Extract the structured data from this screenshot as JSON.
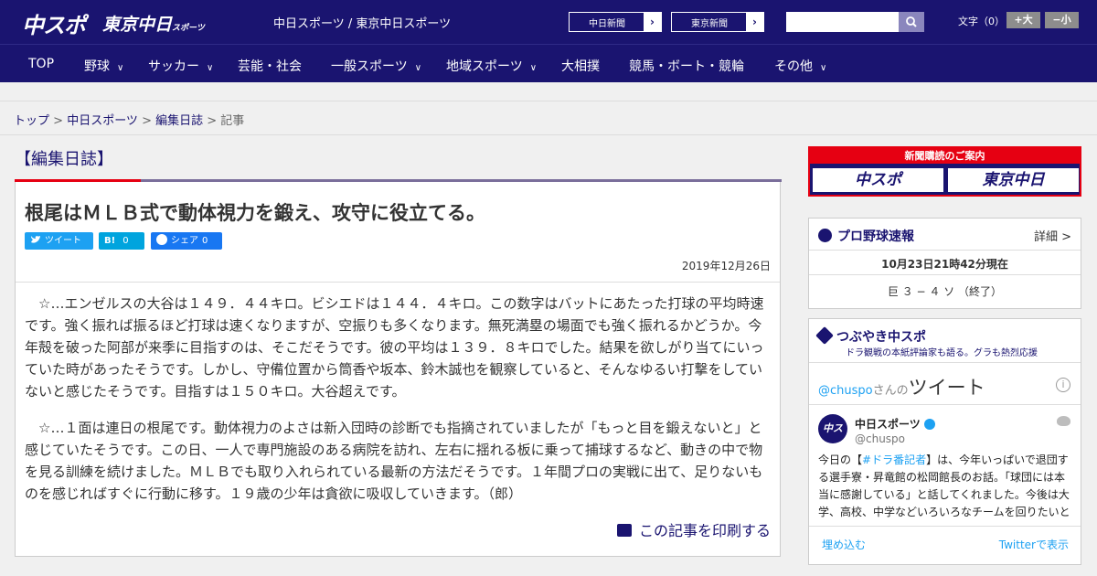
{
  "header": {
    "logo_chuspo": "中スポ",
    "logo_tokyo": "東京中日",
    "logo_tokyo_small": "スポーツ",
    "site_title": "中日スポーツ / 東京中日スポーツ",
    "links": [
      {
        "label": "中日新聞",
        "arrow": "›"
      },
      {
        "label": "東京新聞",
        "arrow": "›"
      }
    ],
    "search_placeholder": "",
    "font_size_label": "文字（0）",
    "font_larger": "+大",
    "font_smaller": "−小"
  },
  "nav": {
    "items": [
      {
        "label": "TOP",
        "has_menu": false
      },
      {
        "label": "野球",
        "has_menu": true
      },
      {
        "label": "サッカー",
        "has_menu": true
      },
      {
        "label": "芸能・社会",
        "has_menu": false
      },
      {
        "label": "一般スポーツ",
        "has_menu": true
      },
      {
        "label": "地域スポーツ",
        "has_menu": true
      },
      {
        "label": "大相撲",
        "has_menu": false
      },
      {
        "label": "競馬・ボート・競輪",
        "has_menu": false
      },
      {
        "label": "その他",
        "has_menu": true
      }
    ],
    "chevron": "∨"
  },
  "breadcrumb": {
    "items": [
      "トップ",
      "中日スポーツ",
      "編集日誌"
    ],
    "separator": " > ",
    "current": "記事"
  },
  "category_title": "【編集日誌】",
  "article": {
    "headline": "根尾はＭＬＢ式で動体視力を鍛え、攻守に役立てる。",
    "share": {
      "tweet": "ツイート",
      "hatena_label": "B!",
      "hatena_count": "0",
      "facebook_label": "シェア",
      "facebook_count": "0"
    },
    "date": "2019年12月26日",
    "paragraphs": [
      "☆…エンゼルスの大谷は１４９．４４キロ。ビシエドは１４４．４キロ。この数字はバットにあたった打球の平均時速です。強く振れば振るほど打球は速くなりますが、空振りも多くなります。無死満塁の場面でも強く振れるかどうか。今年殻を破った阿部が来季に目指すのは、そこだそうです。彼の平均は１３９．８キロでした。結果を欲しがり当てにいっていた時があったそうです。しかし、守備位置から筒香や坂本、鈴木誠也を観察していると、そんなゆるい打撃をしていないと感じたそうです。目指すは１５０キロ。大谷超えです。",
      "☆…１面は連日の根尾です。動体視力のよさは新入団時の診断でも指摘されていましたが「もっと目を鍛えないと」と感じていたそうです。この日、一人で専門施設のある病院を訪れ、左右に揺れる板に乗って捕球するなど、動きの中で物を見る訓練を続けました。ＭＬＢでも取り入れられている最新の方法だそうです。１年間プロの実戦に出て、足りないものを感じればすぐに行動に移す。１９歳の少年は貪欲に吸収していきます。（郎）"
    ],
    "print_label": "この記事を印刷する"
  },
  "sidebar": {
    "ad": {
      "banner": "新聞購読のご案内",
      "logo1": "中スポ",
      "logo2": "東京中日"
    },
    "score": {
      "title": "プロ野球速報",
      "detail": "詳細 >",
      "time": "10月23日21時42分現在",
      "game": "巨 ３ − ４ ソ （終了）"
    },
    "twitter": {
      "title": "つぶやき中スポ",
      "subtitle": "ドラ観戦の本紙評論家も語る。グラも熱烈応援",
      "handle": "@chuspo",
      "handle_suffix": "さんの",
      "tweets_label": "ツイート",
      "info": "i",
      "avatar_text": "中スポ",
      "account_name": "中日スポーツ",
      "account_at": "@chuspo",
      "tweet_pre": "今日の【",
      "tweet_tag": "#ドラ番記者",
      "tweet_post": "】は、今年いっぱいで退団する選手寮・昇竜館の松岡館長のお話。「球団には本当に感謝している」と話してくれました。今後は大学、高校、中学などいろいろなチームを回りたいと",
      "embed": "埋め込む",
      "view_on": "Twitterで表示"
    }
  },
  "colors": {
    "brand": "#1a1470",
    "accent": "#e60012",
    "twitter": "#1da1f2"
  }
}
